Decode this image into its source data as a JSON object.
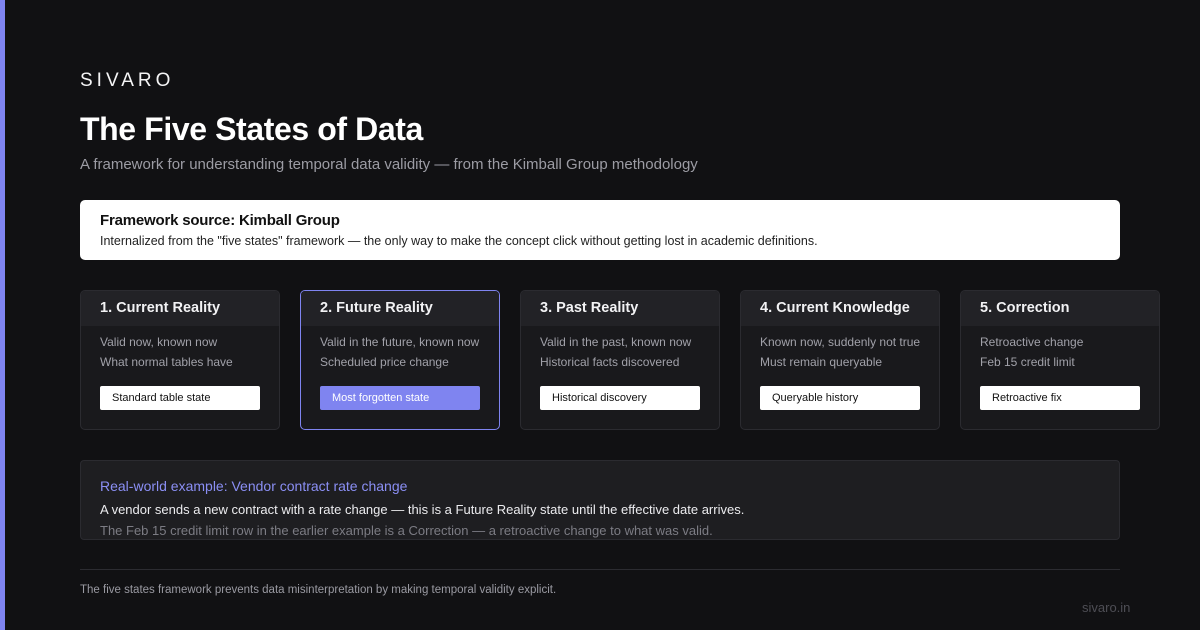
{
  "brand": "SIVARO",
  "title": "The Five States of Data",
  "subtitle": "A framework for understanding temporal data validity — from the Kimball Group methodology",
  "source": {
    "title": "Framework source: Kimball Group",
    "description": "Internalized from the \"five states\" framework — the only way to make the concept click without getting lost in academic definitions."
  },
  "cards": [
    {
      "title": "1. Current Reality",
      "line1": "Valid now, known now",
      "line2": "What normal tables have",
      "tag": "Standard table state"
    },
    {
      "title": "2. Future Reality",
      "line1": "Valid in the future, known now",
      "line2": "Scheduled price change",
      "tag": "Most forgotten state"
    },
    {
      "title": "3. Past Reality",
      "line1": "Valid in the past, known now",
      "line2": "Historical facts discovered",
      "tag": "Historical discovery"
    },
    {
      "title": "4. Current Knowledge",
      "line1": "Known now, suddenly not true",
      "line2": "Must remain queryable",
      "tag": "Queryable history"
    },
    {
      "title": "5. Correction",
      "line1": "Retroactive change",
      "line2": "Feb 15 credit limit",
      "tag": "Retroactive fix"
    }
  ],
  "example": {
    "title": "Real-world example: Vendor contract rate change",
    "line1": "A vendor sends a new contract with a rate change — this is a Future Reality state until the effective date arrives.",
    "line2": "The Feb 15 credit limit row in the earlier example is a Correction — a retroactive change to what was valid."
  },
  "footer": {
    "note": "The five states framework prevents data misinterpretation by making temporal validity explicit.",
    "site": "sivaro.in"
  },
  "colors": {
    "background": "#111113",
    "accent": "#7f84f0",
    "card": "#19191c"
  }
}
